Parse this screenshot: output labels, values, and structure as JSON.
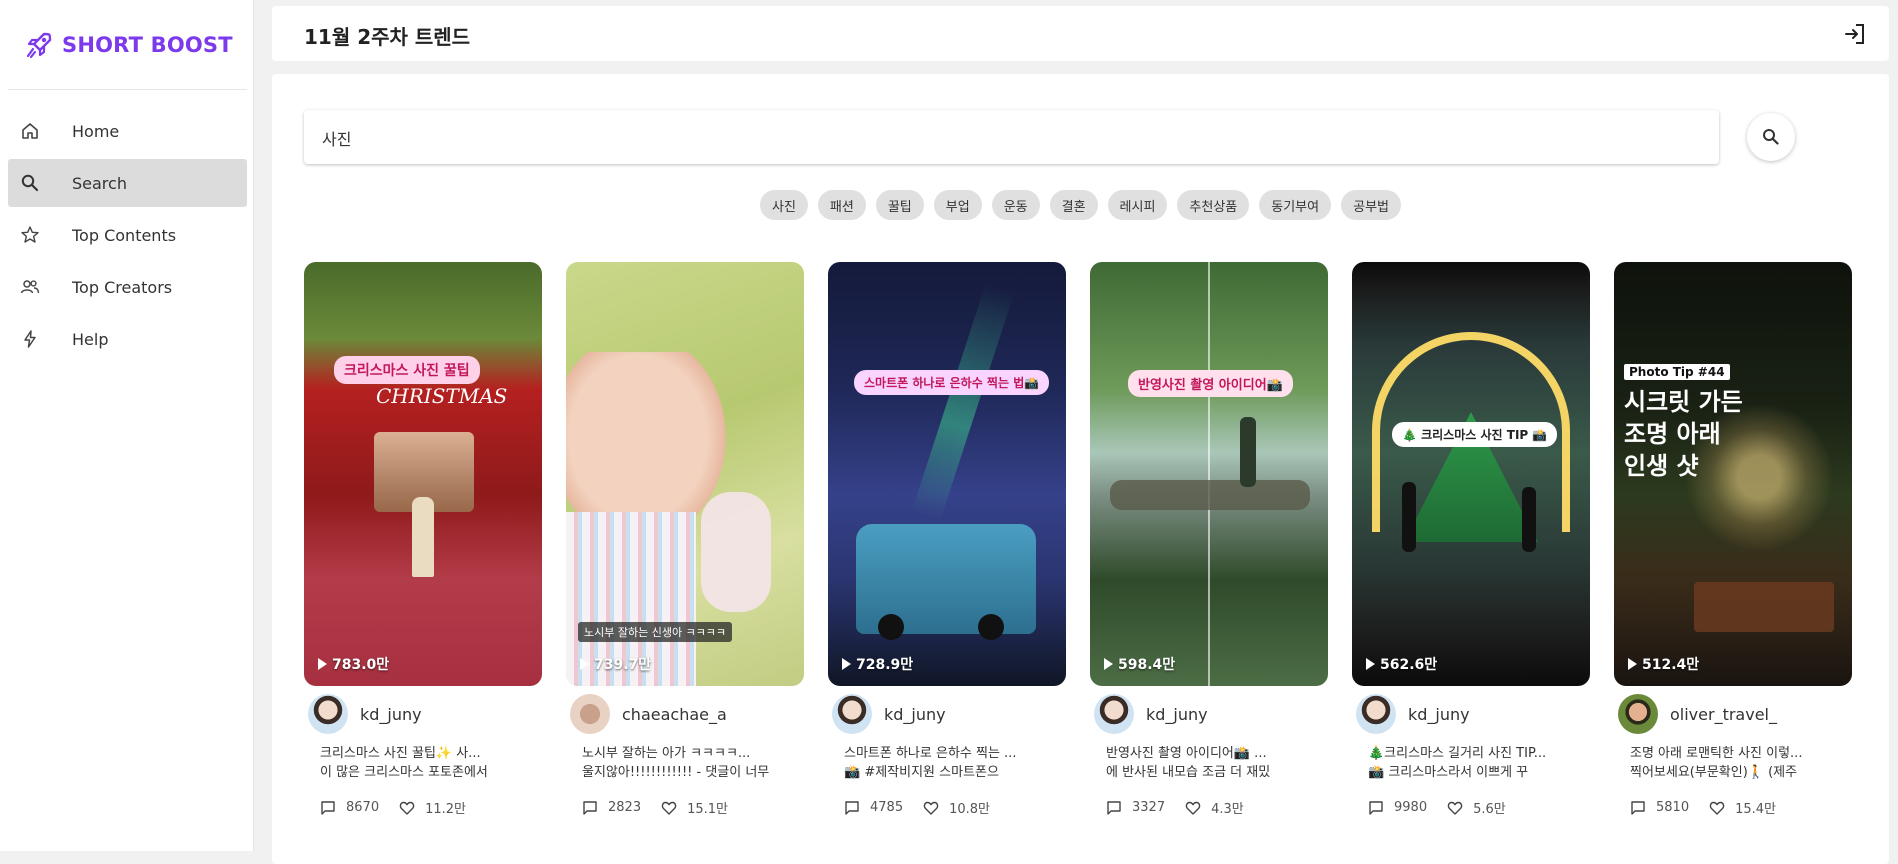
{
  "brand": {
    "name": "SHORT BOOST",
    "color": "#7c3aed"
  },
  "sidebar": {
    "items": [
      {
        "label": "Home",
        "icon": "home-icon",
        "active": false
      },
      {
        "label": "Search",
        "icon": "search-icon",
        "active": true
      },
      {
        "label": "Top Contents",
        "icon": "star-icon",
        "active": false
      },
      {
        "label": "Top Creators",
        "icon": "people-icon",
        "active": false
      },
      {
        "label": "Help",
        "icon": "bolt-icon",
        "active": false
      }
    ]
  },
  "header": {
    "title": "11월 2주차 트렌드",
    "logout_icon": "logout-icon"
  },
  "search": {
    "value": "사진",
    "button_icon": "search-icon"
  },
  "chips": [
    "사진",
    "패션",
    "꿀팁",
    "부업",
    "운동",
    "결혼",
    "레시피",
    "추천상품",
    "동기부여",
    "공부법"
  ],
  "cards": [
    {
      "views": "783.0만",
      "overlay": "크리스마스 사진 꿀팁",
      "overlay_sub": "CHRISTMAS",
      "creator": "kd_juny",
      "desc_line1": "크리스마스 사진 꿀팁✨     사...",
      "desc_line2": "이 많은 크리스마스 포토존에서",
      "comments": "8670",
      "likes": "11.2만"
    },
    {
      "views": "739.7만",
      "overlay": "노시부 잘하는 신생아 ㅋㅋㅋㅋ",
      "creator": "chaeachae_a",
      "desc_line1": "노시부 잘하는 아가 ㅋㅋㅋㅋ...",
      "desc_line2": "울지않아!!!!!!!!!!!! - 댓글이 너무",
      "comments": "2823",
      "likes": "15.1만"
    },
    {
      "views": "728.9만",
      "overlay": "스마트폰 하나로 은하수 찍는 법📸",
      "creator": "kd_juny",
      "desc_line1": "스마트폰 하나로 은하수 찍는 ...",
      "desc_line2": "📸 #제작비지원     스마트폰으",
      "comments": "4785",
      "likes": "10.8만"
    },
    {
      "views": "598.4만",
      "overlay": "반영사진 촬영 아이디어📸",
      "creator": "kd_juny",
      "desc_line1": "반영사진 촬영 아이디어📸     ...",
      "desc_line2": "에 반사된 내모습 조금 더 재밌",
      "comments": "3327",
      "likes": "4.3만"
    },
    {
      "views": "562.6만",
      "overlay": "🎄 크리스마스 사진 TIP 📸",
      "creator": "kd_juny",
      "desc_line1": "🎄크리스마스 길거리 사진 TIP...",
      "desc_line2": "📸     크리스마스라서 이쁘게 꾸",
      "comments": "9980",
      "likes": "5.6만"
    },
    {
      "views": "512.4만",
      "overlay": "Photo Tip #44",
      "overlay_big": [
        "시크릿 가든",
        "조명 아래",
        "인생 샷"
      ],
      "creator": "oliver_travel_",
      "desc_line1": "조명 아래 로맨틱한 사진 이렇...",
      "desc_line2": "찍어보세요(부문확인)🚶 (제주",
      "comments": "5810",
      "likes": "15.4만"
    }
  ]
}
